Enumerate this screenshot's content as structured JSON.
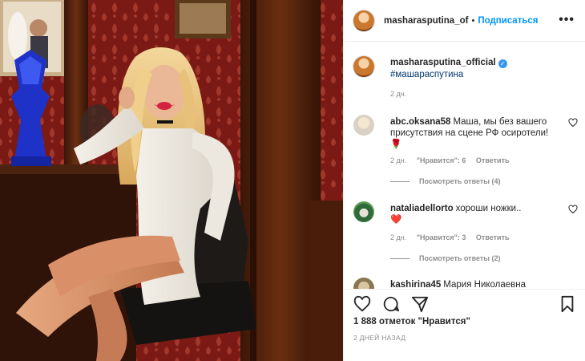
{
  "post": {
    "username": "masharasputina_of",
    "follow_label": "Подписаться",
    "more_label": "•••"
  },
  "caption": {
    "username": "masharasputina_official",
    "hashtag": "#машараспутина",
    "time": "2 дн."
  },
  "comments": [
    {
      "username": "abc.oksana58",
      "text": "Маша, мы без вашего присутствия на сцене РФ осиротели!🌹",
      "time": "2 дн.",
      "likes": "\"Нравится\": 6",
      "reply_label": "Ответить",
      "replies_label": "Посмотреть ответы (4)"
    },
    {
      "username": "nataliadellorto",
      "text": "хороши ножки..",
      "emoji": "❤️",
      "time": "2 дн.",
      "likes": "\"Нравится\": 3",
      "reply_label": "Ответить",
      "replies_label": "Посмотреть ответы (2)"
    },
    {
      "username": "kashirina45",
      "text": "Мария Николаевна"
    }
  ],
  "footer": {
    "likes_count": "1 888 отметок \"Нравится\"",
    "date": "2 ДНЕЙ НАЗАД",
    "icons": [
      "heart-icon",
      "comment-icon",
      "share-icon",
      "bookmark-icon"
    ]
  },
  "colors": {
    "accent": "#0095f6",
    "hashtag": "#00376b",
    "muted": "#8e8e8e",
    "wallpaper": "#7b1a14"
  }
}
